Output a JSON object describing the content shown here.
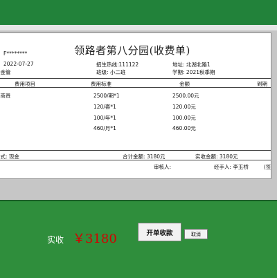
{
  "receipt": {
    "title": "领路者第八分园(收费单)",
    "student_id": "F********",
    "date": "2022-07-27",
    "hotline": "招生热线:111122",
    "address": "地址: 北湖北路1",
    "name": "孙金管",
    "class": "班级: 小二班",
    "term": "学期: 2021秋季期",
    "columns": [
      "费用项目",
      "费用标准",
      "金额",
      "到期"
    ],
    "rows": [
      {
        "item": "育商贵",
        "standard": "2500/期*1",
        "amount": "2500.00元"
      },
      {
        "item": "",
        "standard": "120/套*1",
        "amount": "120.00元"
      },
      {
        "item": "费",
        "standard": "100/年*1",
        "amount": "100.00元"
      },
      {
        "item": "费",
        "standard": "460/月*1",
        "amount": "460.00元"
      }
    ],
    "payment_method": "方式: 现金",
    "total": "合计金额: 3180元",
    "received": "实收金额: 3180元",
    "reviewer": "审核人:",
    "handler": "经手人: 李玉桥",
    "handler_suffix": "(签"
  },
  "payment": {
    "label": "实收",
    "amount": "￥3180"
  },
  "buttons": {
    "charge": "开单收款",
    "cancel": "取消"
  }
}
